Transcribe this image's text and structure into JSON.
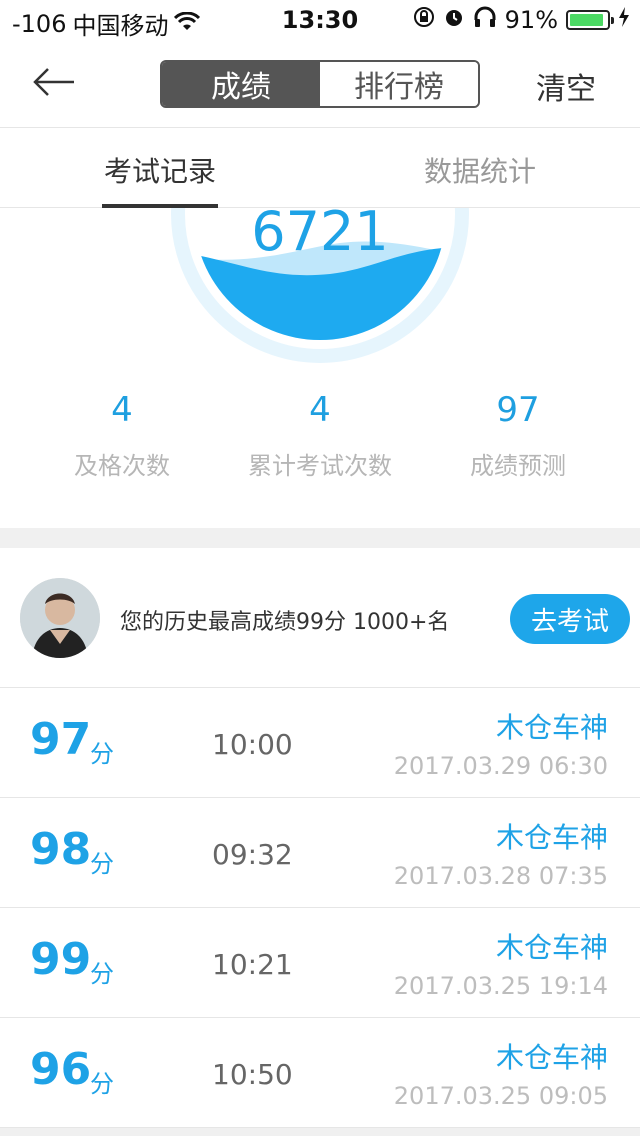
{
  "status_bar": {
    "signal": "-106",
    "carrier": "中国移动",
    "wifi_icon": "wifi-icon",
    "time": "13:30",
    "battery_percent": "91%",
    "battery_level": 0.91,
    "colors": {
      "battery": "#4cd964"
    }
  },
  "nav": {
    "back_icon": "arrow-left-icon",
    "segments": {
      "scores": "成绩",
      "ranking": "排行榜"
    },
    "clear": "清空"
  },
  "tabs": {
    "records": "考试记录",
    "stats": "数据统计"
  },
  "gauge": {
    "number": "6721"
  },
  "stats": [
    {
      "value": "4",
      "label": "及格次数"
    },
    {
      "value": "4",
      "label": "累计考试次数"
    },
    {
      "value": "97",
      "label": "成绩预测"
    }
  ],
  "user": {
    "best_text": "您的历史最高成绩99分  1000+名",
    "go_exam": "去考试"
  },
  "records": [
    {
      "score": "97",
      "unit": "分",
      "duration": "10:00",
      "name": "木仓车神",
      "date": "2017.03.29 06:30"
    },
    {
      "score": "98",
      "unit": "分",
      "duration": "09:32",
      "name": "木仓车神",
      "date": "2017.03.28 07:35"
    },
    {
      "score": "99",
      "unit": "分",
      "duration": "10:21",
      "name": "木仓车神",
      "date": "2017.03.25 19:14"
    },
    {
      "score": "96",
      "unit": "分",
      "duration": "10:50",
      "name": "木仓车神",
      "date": "2017.03.25 09:05"
    }
  ],
  "colors": {
    "accent": "#1ea2e6",
    "water": "#1eaaf0"
  }
}
